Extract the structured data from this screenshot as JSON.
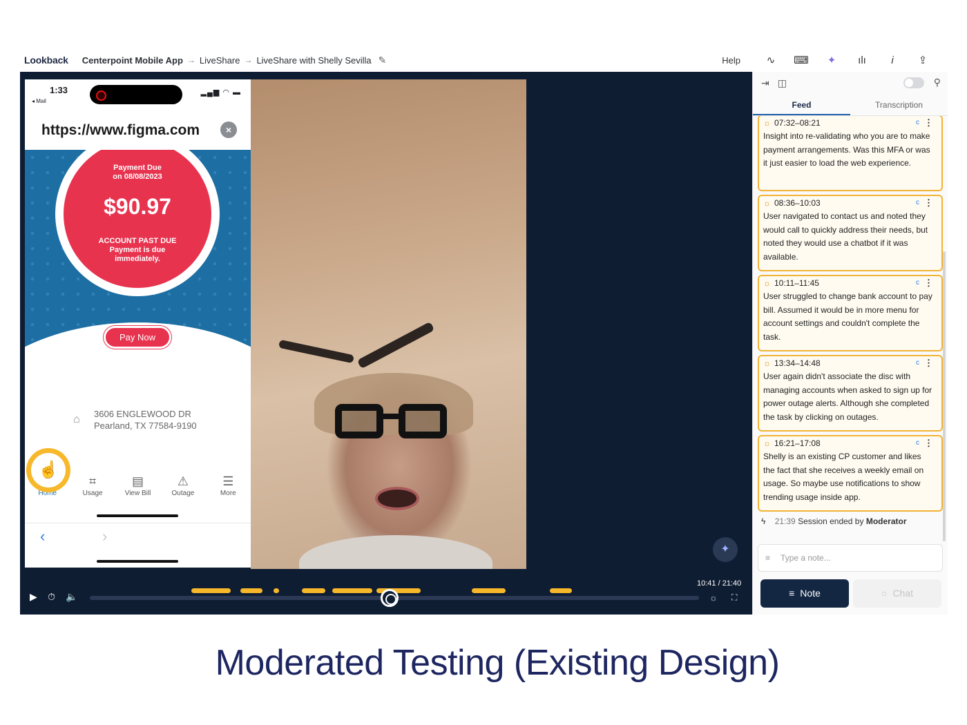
{
  "app": {
    "logo": "Lookback"
  },
  "breadcrumb": {
    "project": "Centerpoint Mobile App",
    "arrow": "→",
    "section": "LiveShare",
    "session": "LiveShare with Shelly Sevilla"
  },
  "toolbar": {
    "help": "Help",
    "icons": [
      "activity-icon",
      "keyboard-icon",
      "sparkle-icon",
      "waveform-icon",
      "info-icon",
      "share-icon"
    ]
  },
  "phone": {
    "time": "1:33",
    "back_app": "◂ Mail",
    "url": "https://www.figma.com",
    "payment_due": "Payment Due",
    "due_date": "on 08/08/2023",
    "amount": "$90.97",
    "past_due_title": "ACCOUNT PAST DUE",
    "past_due_line1": "Payment is due",
    "past_due_line2": "immediately.",
    "pay_now": "Pay Now",
    "address_line1": "3606 ENGLEWOOD DR",
    "address_line2": "Pearland, TX 77584-9190",
    "tabs": [
      "Home",
      "Usage",
      "View Bill",
      "Outage",
      "More"
    ]
  },
  "player": {
    "timecode": "10:41 / 21:40",
    "progress": 0.493
  },
  "panel": {
    "tabs": {
      "feed": "Feed",
      "transcription": "Transcription"
    },
    "cards": [
      {
        "time": "07:32–08:21",
        "tag": "c",
        "text": "Insight into re-validating who you are to make payment arrangements. Was this MFA or was it just easier to load the web experience."
      },
      {
        "time": "08:36–10:03",
        "tag": "c",
        "text": "User navigated to contact us and noted they would call to quickly address their needs, but noted they would use a chatbot if it was available."
      },
      {
        "time": "10:11–11:45",
        "tag": "c",
        "text": "User struggled to change bank account to pay bill. Assumed it would be in more menu for account settings and couldn't complete the task."
      },
      {
        "time": "13:34–14:48",
        "tag": "c",
        "text": "User again didn't associate the disc with managing accounts when asked to sign up for power outage alerts. Although she completed the task by clicking on outages."
      },
      {
        "time": "16:21–17:08",
        "tag": "c",
        "text": "Shelly is an existing CP customer and likes the fact that she receives a weekly email on usage. So maybe use notifications to show trending usage inside app."
      }
    ],
    "session_end": {
      "time": "21:39",
      "text": "Session ended by",
      "who": "Moderator"
    },
    "note_placeholder": "Type a note...",
    "note_button": "Note",
    "chat_button": "Chat"
  },
  "caption": "Moderated Testing (Existing Design)"
}
